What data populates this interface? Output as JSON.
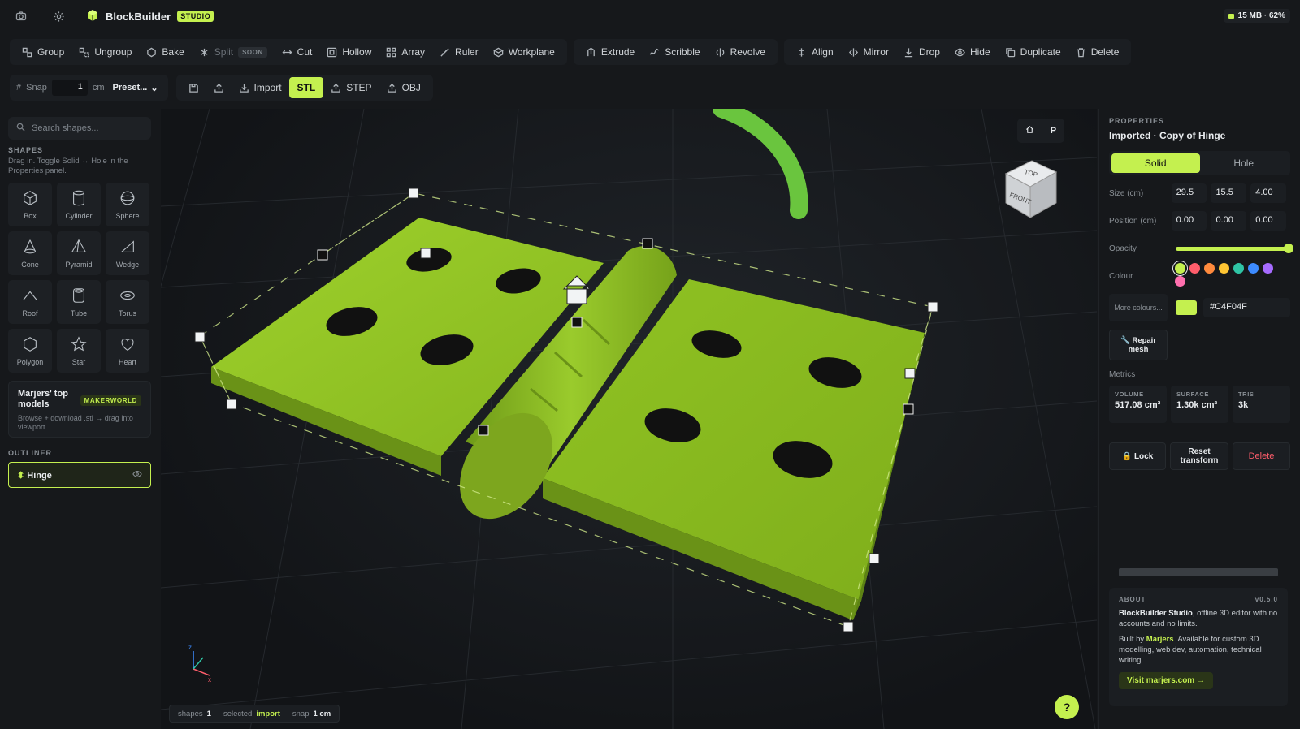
{
  "app": {
    "name": "BlockBuilder",
    "badge": "STUDIO",
    "memory": "15 MB · 62%"
  },
  "toolbar": {
    "group": "Group",
    "ungroup": "Ungroup",
    "bake": "Bake",
    "split": "Split",
    "split_badge": "SOON",
    "cut": "Cut",
    "hollow": "Hollow",
    "array": "Array",
    "ruler": "Ruler",
    "workplane": "Workplane",
    "extrude": "Extrude",
    "scribble": "Scribble",
    "revolve": "Revolve",
    "align": "Align",
    "mirror": "Mirror",
    "drop": "Drop",
    "hide": "Hide",
    "duplicate": "Duplicate",
    "delete": "Delete"
  },
  "toolbar2": {
    "snap_label": "Snap",
    "snap_value": "1",
    "snap_unit": "cm",
    "preset": "Preset...",
    "import": "Import",
    "stl": "STL",
    "step": "STEP",
    "obj": "OBJ"
  },
  "left": {
    "search_placeholder": "Search shapes...",
    "shapes_heading": "SHAPES",
    "shapes_hint": "Drag in. Toggle Solid ↔ Hole in the Properties panel.",
    "shapes": [
      "Box",
      "Cylinder",
      "Sphere",
      "Cone",
      "Pyramid",
      "Wedge",
      "Roof",
      "Tube",
      "Torus",
      "Polygon",
      "Star",
      "Heart"
    ],
    "makerworld_title": "Marjers' top models",
    "makerworld_tag": "MAKERWORLD",
    "makerworld_sub": "Browse + download .stl → drag into viewport",
    "outliner_heading": "OUTLINER",
    "outliner_item": "Hinge"
  },
  "viewport": {
    "view_p": "P",
    "cube_top": "TOP",
    "cube_front": "FRONT",
    "status": {
      "shapes_label": "shapes",
      "shapes_value": "1",
      "selected_label": "selected",
      "selected_value": "import",
      "snap_label": "snap",
      "snap_value": "1 cm"
    },
    "help": "?"
  },
  "props": {
    "heading": "PROPERTIES",
    "title": "Imported · Copy of Hinge",
    "solid": "Solid",
    "hole": "Hole",
    "size_label": "Size (cm)",
    "size": [
      "29.5",
      "15.5",
      "4.00"
    ],
    "position_label": "Position (cm)",
    "position": [
      "0.00",
      "0.00",
      "0.00"
    ],
    "opacity_label": "Opacity",
    "opacity": 1.0,
    "colour_label": "Colour",
    "swatches": [
      "#c4f04f",
      "#ff5d6b",
      "#ff8a3d",
      "#ffc533",
      "#2fc4a5",
      "#3d8bff",
      "#a66bff",
      "#ff6fae"
    ],
    "more_colours": "More colours...",
    "hex": "#C4F04F",
    "repair": "Repair mesh",
    "metrics_label": "Metrics",
    "volume_label": "VOLUME",
    "volume": "517.08 cm³",
    "surface_label": "SURFACE",
    "surface": "1.30k cm²",
    "tris_label": "TRIS",
    "tris": "3k",
    "lock": "Lock",
    "reset": "Reset transform",
    "delete": "Delete"
  },
  "about": {
    "heading": "ABOUT",
    "version": "v0.5.0",
    "p1_bold": "BlockBuilder Studio",
    "p1": ", offline 3D editor with no accounts and no limits.",
    "p2_pre": "Built by ",
    "p2_link": "Marjers",
    "p2": ". Available for custom 3D modelling, web dev, automation, technical writing.",
    "visit": "Visit marjers.com →"
  }
}
